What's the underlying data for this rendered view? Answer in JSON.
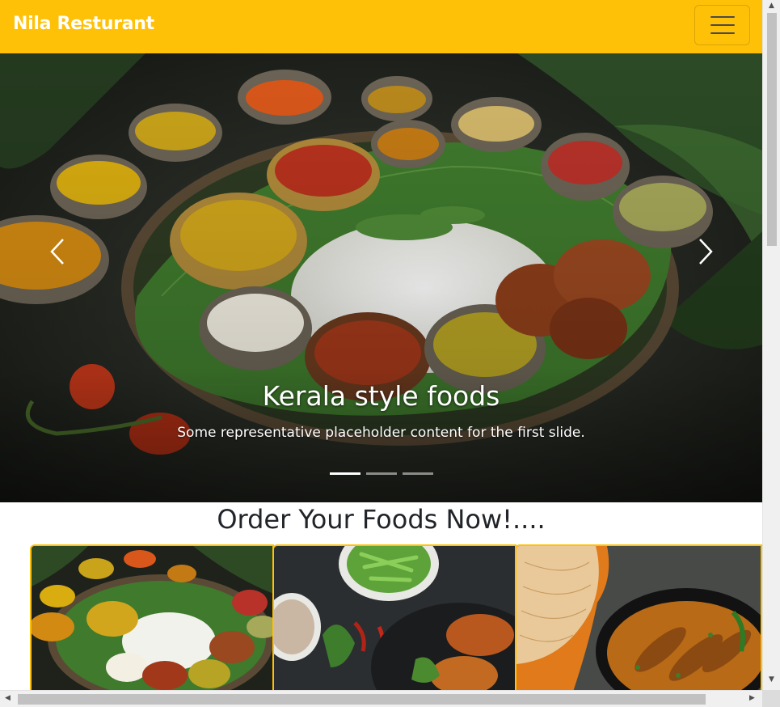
{
  "navbar": {
    "brand": "Nila Resturant",
    "toggler_icon": "hamburger-menu-icon"
  },
  "carousel": {
    "slides": [
      {
        "title": "Kerala style foods",
        "text": "Some representative placeholder content for the first slide."
      }
    ],
    "indicators": [
      true,
      false,
      false
    ],
    "prev_icon": "chevron-left-icon",
    "next_icon": "chevron-right-icon"
  },
  "menu_section": {
    "title": "Order Your Foods Now!....",
    "cards": [
      {
        "image": "kerala-thali-image"
      },
      {
        "image": "beans-chicken-image"
      },
      {
        "image": "fish-curry-flatbread-image"
      }
    ]
  },
  "colors": {
    "navbar_bg": "#ffc107",
    "brand_text": "#ffffff",
    "card_border": "#ffc107"
  }
}
